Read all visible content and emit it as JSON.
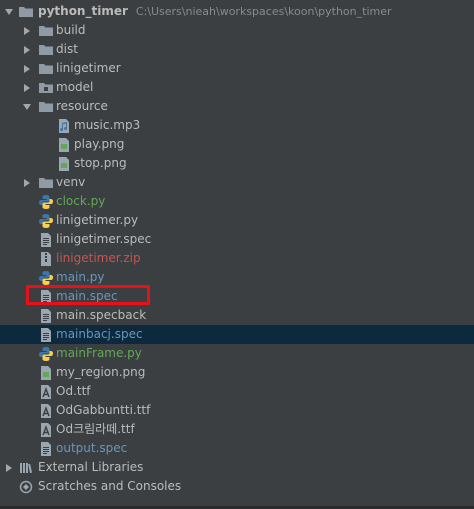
{
  "project": {
    "name": "python_timer",
    "path": "C:\\Users\\nieah\\workspaces\\koon\\python_timer"
  },
  "items": [
    {
      "label": "build",
      "kind": "folder",
      "depth": 1,
      "expanded": false,
      "color": "#bbbbbb"
    },
    {
      "label": "dist",
      "kind": "folder",
      "depth": 1,
      "expanded": false,
      "color": "#bbbbbb"
    },
    {
      "label": "linigetimer",
      "kind": "folder",
      "depth": 1,
      "expanded": false,
      "color": "#bbbbbb"
    },
    {
      "label": "model",
      "kind": "package",
      "depth": 1,
      "expanded": false,
      "color": "#bbbbbb"
    },
    {
      "label": "resource",
      "kind": "folder",
      "depth": 1,
      "expanded": true,
      "color": "#bbbbbb"
    },
    {
      "label": "music.mp3",
      "kind": "audio",
      "depth": 2,
      "color": "#bbbbbb"
    },
    {
      "label": "play.png",
      "kind": "image",
      "depth": 2,
      "color": "#bbbbbb"
    },
    {
      "label": "stop.png",
      "kind": "image",
      "depth": 2,
      "color": "#bbbbbb"
    },
    {
      "label": "venv",
      "kind": "folder",
      "depth": 1,
      "expanded": false,
      "color": "#bbbbbb"
    },
    {
      "label": "clock.py",
      "kind": "python",
      "depth": 1,
      "color": "#62a856"
    },
    {
      "label": "linigetimer.py",
      "kind": "python",
      "depth": 1,
      "color": "#bbbbbb"
    },
    {
      "label": "linigetimer.spec",
      "kind": "text",
      "depth": 1,
      "color": "#bbbbbb"
    },
    {
      "label": "linigetimer.zip",
      "kind": "archive",
      "depth": 1,
      "color": "#c75450"
    },
    {
      "label": "main.py",
      "kind": "python",
      "depth": 1,
      "color": "#6897bb"
    },
    {
      "label": "main.spec",
      "kind": "text",
      "depth": 1,
      "color": "#6897bb",
      "highlighted": true
    },
    {
      "label": "main.specback",
      "kind": "text",
      "depth": 1,
      "color": "#bbbbbb"
    },
    {
      "label": "mainbacj.spec",
      "kind": "text",
      "depth": 1,
      "color": "#6897bb",
      "selected": true
    },
    {
      "label": "mainFrame.py",
      "kind": "python",
      "depth": 1,
      "color": "#62a856"
    },
    {
      "label": "my_region.png",
      "kind": "image",
      "depth": 1,
      "color": "#bbbbbb"
    },
    {
      "label": "Od.ttf",
      "kind": "font",
      "depth": 1,
      "color": "#bbbbbb"
    },
    {
      "label": "OdGabbuntti.ttf",
      "kind": "font",
      "depth": 1,
      "color": "#bbbbbb"
    },
    {
      "label": "Od크림라떼.ttf",
      "kind": "font",
      "depth": 1,
      "color": "#bbbbbb"
    },
    {
      "label": "output.spec",
      "kind": "text",
      "depth": 1,
      "color": "#6897bb"
    }
  ],
  "external_libraries": {
    "label": "External Libraries"
  },
  "scratches": {
    "label": "Scratches and Consoles"
  },
  "colors": {
    "background": "#3c3f41",
    "selected_row": "#0d293e",
    "highlight_box": "#e8101a",
    "folder": "#8f9aa5",
    "python_blue": "#3d76ab",
    "python_yellow": "#f6d14e"
  }
}
